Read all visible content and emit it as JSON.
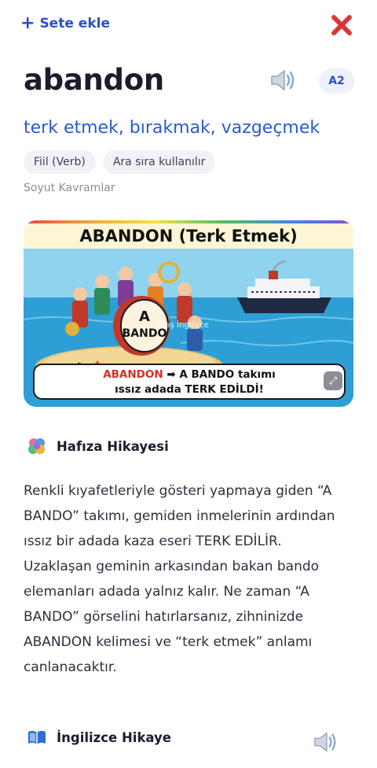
{
  "topbar": {
    "add_set_label": "Sete ekle",
    "add_set_icon": "plus-icon",
    "close_icon": "close-icon",
    "close_color": "#e03a3a"
  },
  "word": {
    "term": "abandon",
    "level": "A2",
    "meaning": "terk etmek, bırakmak, vazgeçmek",
    "tags": [
      "Fiil (Verb)",
      "Ara sıra kullanılır"
    ],
    "category": "Soyut Kavramlar",
    "speaker_icon": "speaker-icon"
  },
  "illustration": {
    "title": "ABANDON (Terk Etmek)",
    "drum_text_line1": "A",
    "drum_text_line2": "BANDO",
    "watermark": "Flaş İngilizce",
    "caption_red": "ABANDON",
    "caption_arrow": "➡",
    "caption_line1_rest": " A BANDO takımı",
    "caption_line2": "ıssız adada TERK EDİLDİ!",
    "expand_icon": "expand-icon"
  },
  "memory": {
    "icon": "brain-icon",
    "title": "Hafıza Hikayesi",
    "story": "Renkli kıyafetleriyle gösteri yapmaya giden “A BANDO” takımı, gemiden inmelerinin ardından ıssız bir adada kaza eseri TERK EDİLİR. Uzaklaşan geminin arkasından bakan bando elemanları adada yalnız kalır. Ne zaman “A BANDO” görselini hatırlarsanız, zihninizde ABANDON kelimesi ve “terk etmek” anlamı canlanacaktır."
  },
  "english": {
    "icon": "book-icon",
    "title": "İngilizce Hikaye"
  },
  "colors": {
    "accent": "#2b4fc7",
    "meaning": "#2b5ad1",
    "close": "#e03a3a"
  }
}
